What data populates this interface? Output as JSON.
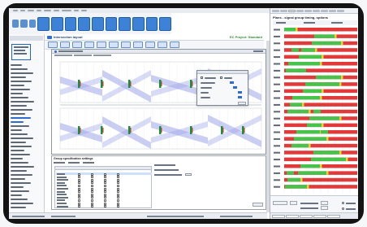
{
  "app": {
    "window_title": "Intersection layout",
    "project_label": "EC Project: Standard"
  },
  "right_panel": {
    "title": "Plans - signal group timing, options"
  },
  "lower_panel": {
    "title": "Group specification settings"
  },
  "colors": {
    "accent": "#2f6bd1",
    "project_green": "#2e8b2e",
    "bezel": "#141414",
    "timing_green": "#47c24b",
    "timing_red": "#e23a3a",
    "timing_yellow": "#e7d52c",
    "plot_band": "#9ea6e8"
  },
  "icons": [
    "grid-icon",
    "layout-icon",
    "camera-icon",
    "plan-icon",
    "signal-icon",
    "eye-icon",
    "person-icon",
    "export-icon",
    "search-icon",
    "settings-icon"
  ]
}
